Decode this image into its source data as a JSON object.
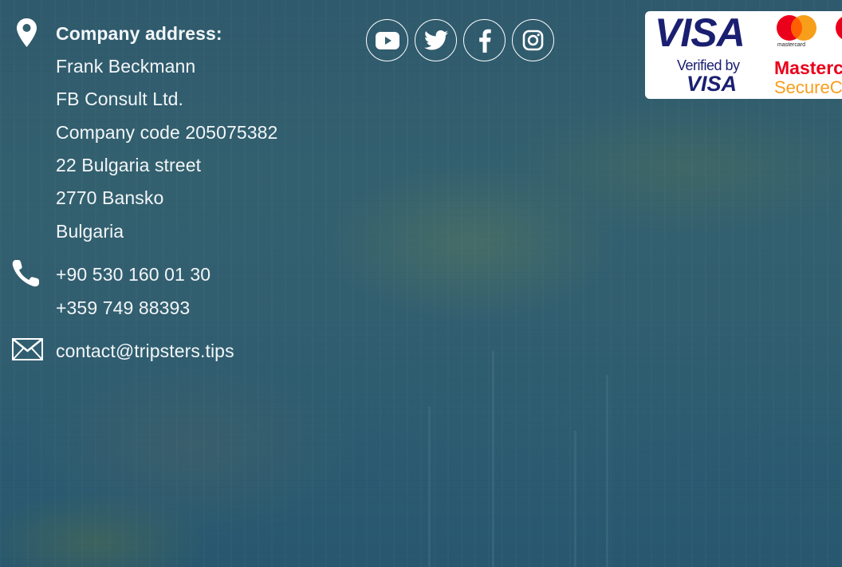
{
  "contact": {
    "address_heading": "Company address:",
    "address_lines": [
      "Frank Beckmann",
      "FB Consult Ltd.",
      "Company code 205075382",
      "22 Bulgaria street",
      "2770 Bansko",
      "Bulgaria"
    ],
    "phones": [
      "+90 530 160 01 30",
      "+359 749 88393"
    ],
    "email": "contact@tripsters.tips",
    "icons": [
      "map-pin-icon",
      "phone-icon",
      "envelope-icon"
    ]
  },
  "social": {
    "links": [
      {
        "name": "youtube",
        "icon": "youtube-icon"
      },
      {
        "name": "twitter",
        "icon": "twitter-icon"
      },
      {
        "name": "facebook",
        "icon": "facebook-icon"
      },
      {
        "name": "instagram",
        "icon": "instagram-icon"
      }
    ]
  },
  "payment": {
    "visa_text": "VISA",
    "verified_by": "Verified by",
    "verified_visa": "VISA",
    "mastercard_small": "mastercard",
    "mastercard_word": "Masterc",
    "securecode_word": "SecureC"
  },
  "colors": {
    "text": "#f2f6f8",
    "visa_blue": "#1a1f71",
    "mc_red": "#eb001b",
    "mc_orange": "#f79e1b"
  }
}
